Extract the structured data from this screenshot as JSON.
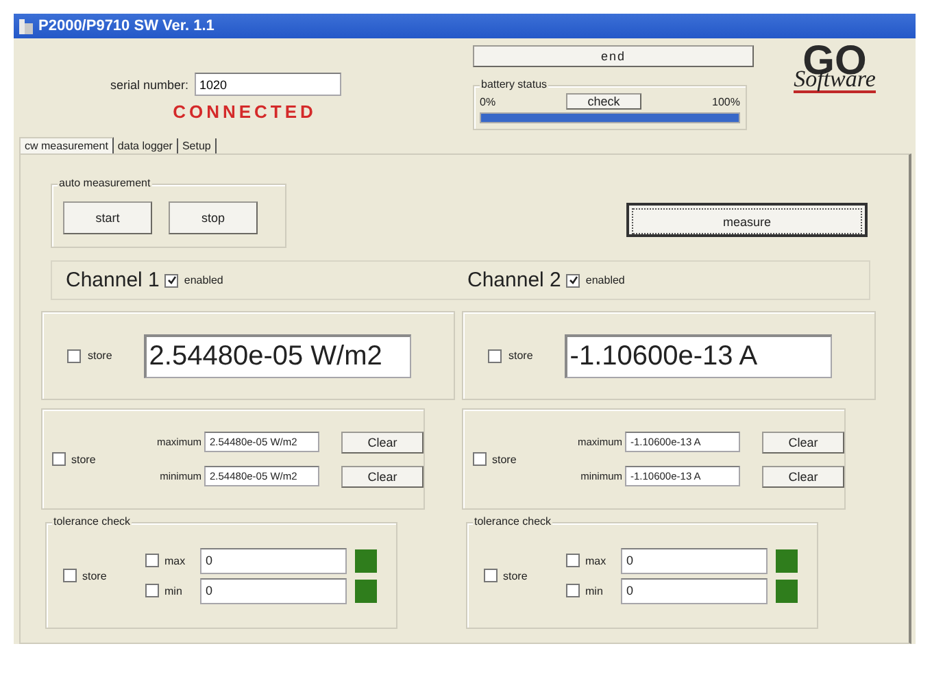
{
  "window": {
    "title": "P2000/P9710 SW Ver. 1.1"
  },
  "serial": {
    "label": "serial number:",
    "value": "1020"
  },
  "connection": {
    "text": "CONNECTED",
    "connected": true
  },
  "end_button": "end",
  "battery": {
    "title": "battery status",
    "min_label": "0%",
    "max_label": "100%",
    "check_button": "check",
    "level": 1
  },
  "logo": {
    "top": "GO",
    "bottom": "Software"
  },
  "tabs": [
    {
      "label": "cw measurement",
      "selected": true
    },
    {
      "label": "data logger",
      "selected": false
    },
    {
      "label": "Setup",
      "selected": false
    }
  ],
  "auto_measurement": {
    "title": "auto measurement",
    "buttons": [
      "start",
      "stop"
    ]
  },
  "measure_button": "measure",
  "channels": [
    {
      "name": "Channel 1",
      "enabled": true,
      "enabled_label": "enabled",
      "store_label": "store",
      "store": false,
      "reading": "2.54480e-05 W/m2",
      "extremes": {
        "store_label": "store",
        "store": false,
        "rows": [
          {
            "label": "maximum",
            "value": "2.54480e-05 W/m2",
            "clear": "Clear"
          },
          {
            "label": "minimum",
            "value": "2.54480e-05 W/m2",
            "clear": "Clear"
          }
        ]
      },
      "tolerance": {
        "title": "tolerance check",
        "store_label": "store",
        "store": false,
        "rows": [
          {
            "label": "max",
            "checked": false,
            "value": "0",
            "color": "#2f7d1c"
          },
          {
            "label": "min",
            "checked": false,
            "value": "0",
            "color": "#2f7d1c"
          }
        ]
      }
    },
    {
      "name": "Channel 2",
      "enabled": true,
      "enabled_label": "enabled",
      "store_label": "store",
      "store": false,
      "reading": "-1.10600e-13 A",
      "extremes": {
        "store_label": "store",
        "store": false,
        "rows": [
          {
            "label": "maximum",
            "value": "-1.10600e-13 A",
            "clear": "Clear"
          },
          {
            "label": "minimum",
            "value": "-1.10600e-13 A",
            "clear": "Clear"
          }
        ]
      },
      "tolerance": {
        "title": "tolerance check",
        "store_label": "store",
        "store": false,
        "rows": [
          {
            "label": "max",
            "checked": false,
            "value": "0",
            "color": "#2f7d1c"
          },
          {
            "label": "min",
            "checked": false,
            "value": "0",
            "color": "#2f7d1c"
          }
        ]
      }
    }
  ]
}
